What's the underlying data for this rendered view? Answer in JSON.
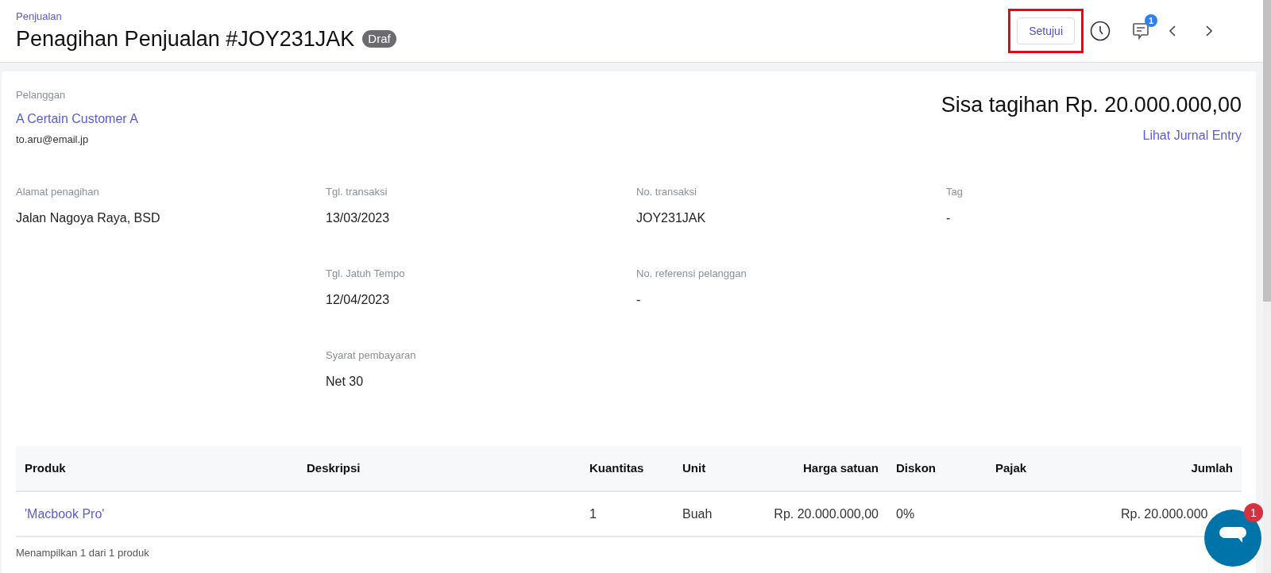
{
  "breadcrumb": "Penjualan",
  "title": "Penagihan Penjualan #JOY231JAK",
  "status_badge": "Draf",
  "actions": {
    "approve_button": "Setujui",
    "approve_highlighted": true,
    "comment_badge": "1"
  },
  "customer": {
    "label": "Pelanggan",
    "name": "A Certain Customer A",
    "email": "to.aru@email.jp"
  },
  "balance": {
    "text": "Sisa tagihan Rp. 20.000.000,00",
    "link": "Lihat Jurnal Entry"
  },
  "details": [
    {
      "fields": [
        {
          "label": "Alamat penagihan",
          "value": "Jalan Nagoya Raya, BSD"
        }
      ]
    },
    {
      "fields": [
        {
          "label": "Tgl. transaksi",
          "value": "13/03/2023"
        },
        {
          "label": "Tgl. Jatuh Tempo",
          "value": "12/04/2023"
        },
        {
          "label": "Syarat pembayaran",
          "value": "Net 30"
        }
      ]
    },
    {
      "fields": [
        {
          "label": "No. transaksi",
          "value": "JOY231JAK"
        },
        {
          "label": "No. referensi pelanggan",
          "value": "-"
        }
      ]
    },
    {
      "fields": [
        {
          "label": "Tag",
          "value": "-"
        }
      ]
    }
  ],
  "table": {
    "columns": [
      {
        "label": "Produk"
      },
      {
        "label": "Deskripsi"
      },
      {
        "label": "Kuantitas"
      },
      {
        "label": "Unit"
      },
      {
        "label": "Harga satuan"
      },
      {
        "label": "Diskon"
      },
      {
        "label": "Pajak"
      },
      {
        "label": "Jumlah"
      }
    ],
    "rows": [
      {
        "cells": [
          {
            "text": "'Macbook Pro'",
            "kind": "link"
          },
          null,
          {
            "text": "1",
            "kind": "text"
          },
          {
            "text": "Buah",
            "kind": "text"
          },
          {
            "text": "Rp. 20.000.000,00",
            "kind": "text"
          },
          {
            "text": "0%",
            "kind": "text"
          },
          null,
          {
            "text": "Rp. 20.000.000",
            "kind": "text"
          }
        ]
      }
    ],
    "footer": "Menampilkan 1 dari 1 produk"
  },
  "chat_widget": {
    "badge": "1"
  }
}
